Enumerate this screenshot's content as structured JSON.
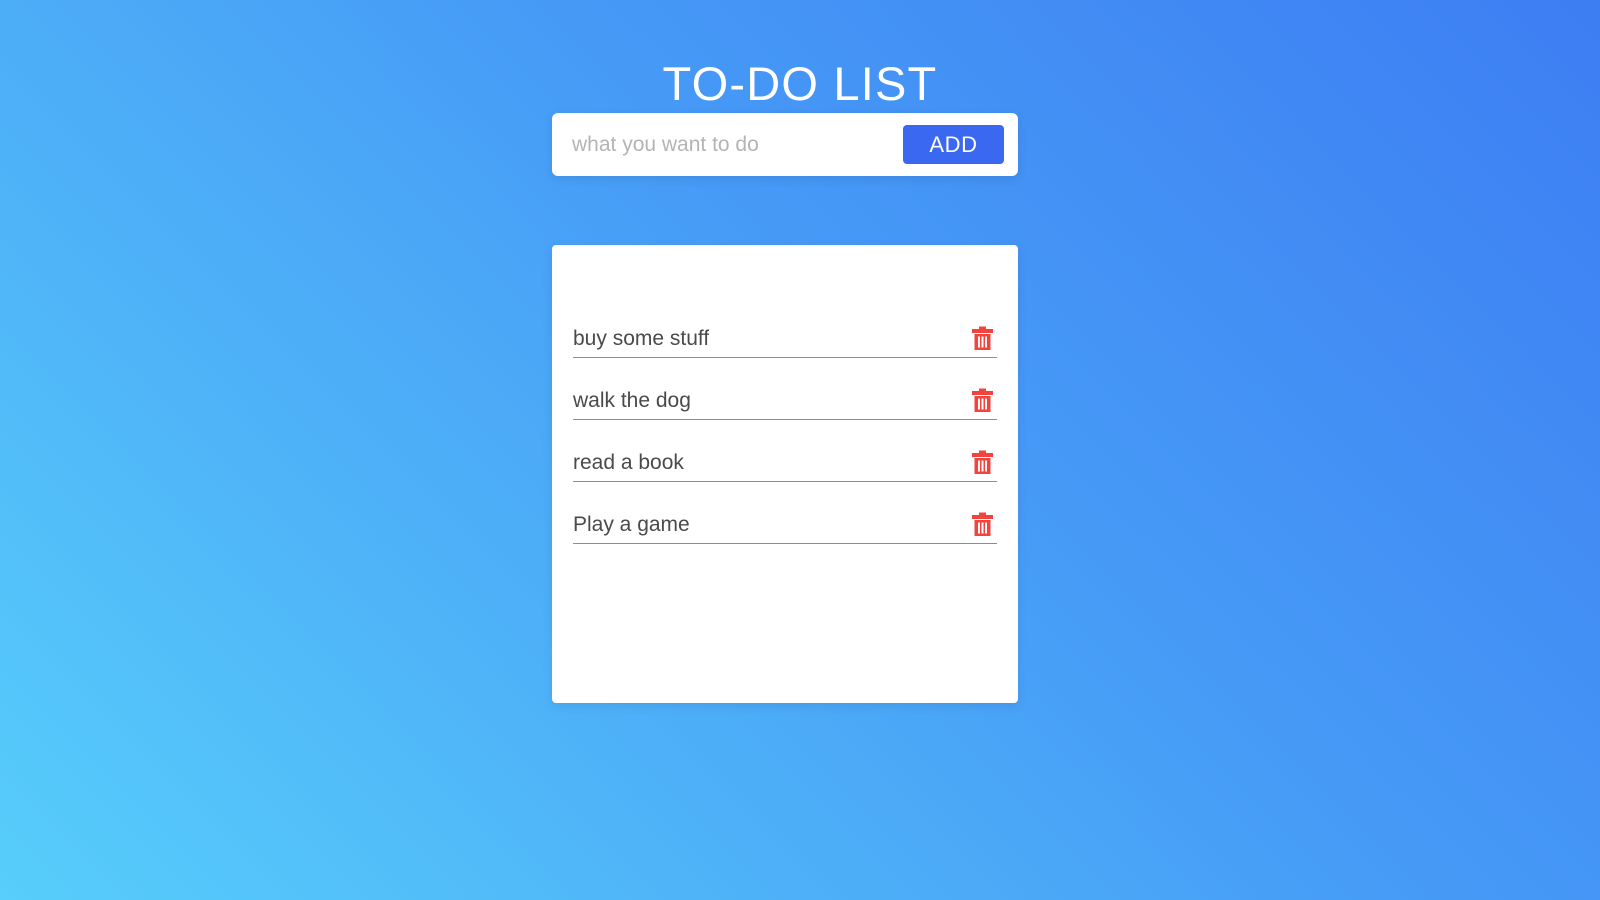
{
  "header": {
    "title": "TO-DO LIST"
  },
  "compose": {
    "input_placeholder": "what you want to do",
    "input_value": "",
    "add_label": "ADD",
    "add_color": "#3b68f0"
  },
  "list": {
    "delete_icon": "trash-icon",
    "delete_color": "#f4433c",
    "items": [
      {
        "text": "buy some stuff"
      },
      {
        "text": "walk the dog"
      },
      {
        "text": "read a book"
      },
      {
        "text": "Play a game"
      }
    ]
  },
  "theme": {
    "background_from": "#57cefb",
    "background_to": "#3d7ef3",
    "card_background": "#ffffff",
    "text_color": "#4a4a4a",
    "placeholder_color": "#b4b4b4"
  }
}
